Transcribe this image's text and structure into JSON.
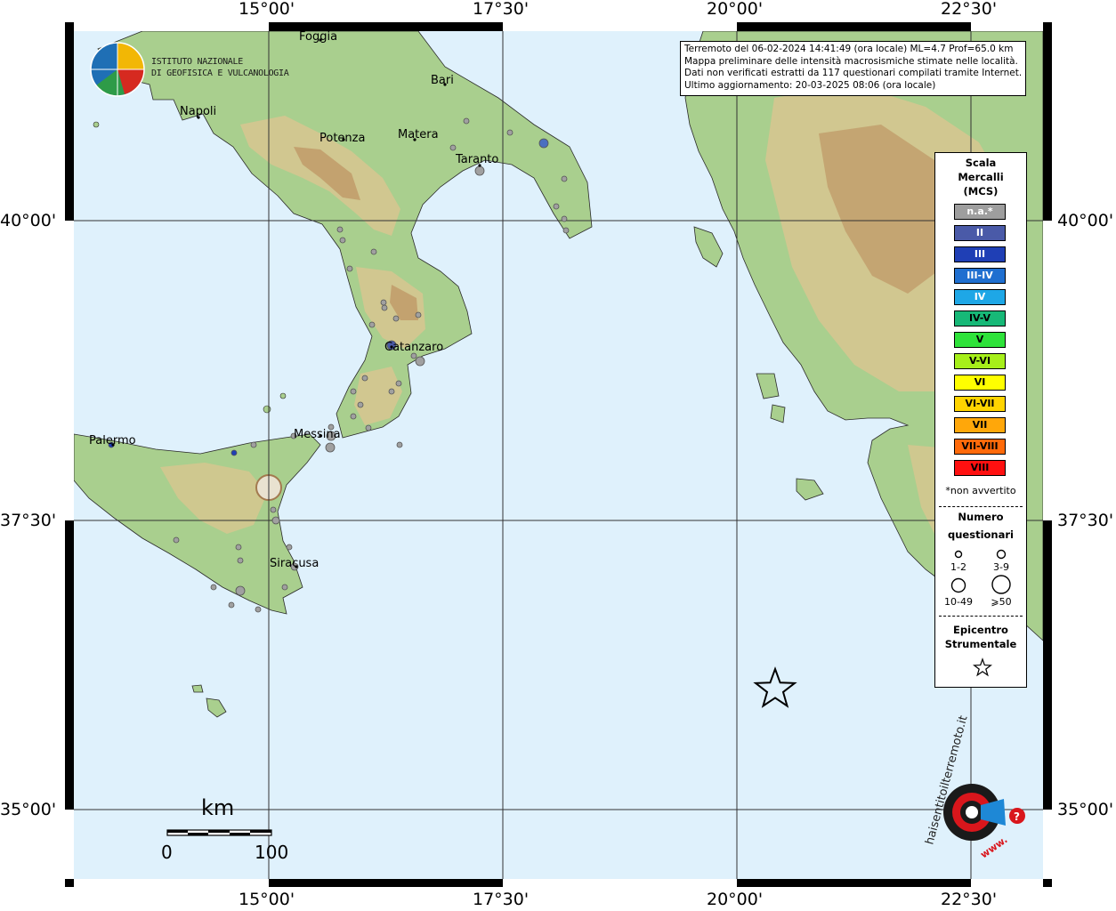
{
  "info": {
    "line1": "Terremoto del 06-02-2024 14:41:49 (ora locale) ML=4.7 Prof=65.0 km",
    "line2": "Mappa preliminare delle intensità macrosismiche stimate nelle località.",
    "line3": "Dati non verificati estratti da 117 questionari compilati tramite Internet.",
    "line4": "Ultimo aggiornamento: 20-03-2025 08:06 (ora locale)"
  },
  "axes": {
    "lon_labels": [
      "15°00'",
      "17°30'",
      "20°00'",
      "22°30'"
    ],
    "lat_labels": [
      "40°00'",
      "37°30'",
      "35°00'"
    ]
  },
  "cities": [
    {
      "name": "Foggia"
    },
    {
      "name": "Bari"
    },
    {
      "name": "Napoli"
    },
    {
      "name": "Potenza"
    },
    {
      "name": "Matera"
    },
    {
      "name": "Taranto"
    },
    {
      "name": "Catanzaro"
    },
    {
      "name": "Messina"
    },
    {
      "name": "Palermo"
    },
    {
      "name": "Siracusa"
    }
  ],
  "logo_ingv": {
    "line1": "ISTITUTO NAZIONALE",
    "line2": "DI GEOFISICA E VULCANOLOGIA"
  },
  "logo_hsit": {
    "text": "haisentitoilterremoto.it",
    "www": "www."
  },
  "legend": {
    "title1": "Scala",
    "title2": "Mercalli",
    "title3": "(MCS)",
    "scale": [
      {
        "label": "n.a.*",
        "color": "#9e9e9e",
        "text": "#ffffff"
      },
      {
        "label": "II",
        "color": "#4a5aa8",
        "text": "#ffffff"
      },
      {
        "label": "III",
        "color": "#1f3fb5",
        "text": "#ffffff"
      },
      {
        "label": "III-IV",
        "color": "#1f6fd0",
        "text": "#ffffff"
      },
      {
        "label": "IV",
        "color": "#1ea7e6",
        "text": "#ffffff"
      },
      {
        "label": "IV-V",
        "color": "#17b877",
        "text": "#000000"
      },
      {
        "label": "V",
        "color": "#2ee23a",
        "text": "#000000"
      },
      {
        "label": "V-VI",
        "color": "#a6ef1a",
        "text": "#000000"
      },
      {
        "label": "VI",
        "color": "#ffff00",
        "text": "#000000"
      },
      {
        "label": "VI-VII",
        "color": "#ffd400",
        "text": "#000000"
      },
      {
        "label": "VII",
        "color": "#ffa70a",
        "text": "#000000"
      },
      {
        "label": "VII-VIII",
        "color": "#ff6a0a",
        "text": "#000000"
      },
      {
        "label": "VIII",
        "color": "#ff1010",
        "text": "#000000"
      }
    ],
    "not_felt": "*non avvertito",
    "count_title1": "Numero",
    "count_title2": "questionari",
    "counts": [
      "1-2",
      "3-9",
      "10-49",
      "⩾50"
    ],
    "epi1": "Epicentro",
    "epi2": "Strumentale"
  },
  "scalebar": {
    "unit": "km",
    "min": "0",
    "max": "100"
  },
  "colors": {
    "sea": "#dff1fc",
    "land_low": "#a9cf8e",
    "land_mid": "#d8c690",
    "land_high": "#b9895a"
  }
}
